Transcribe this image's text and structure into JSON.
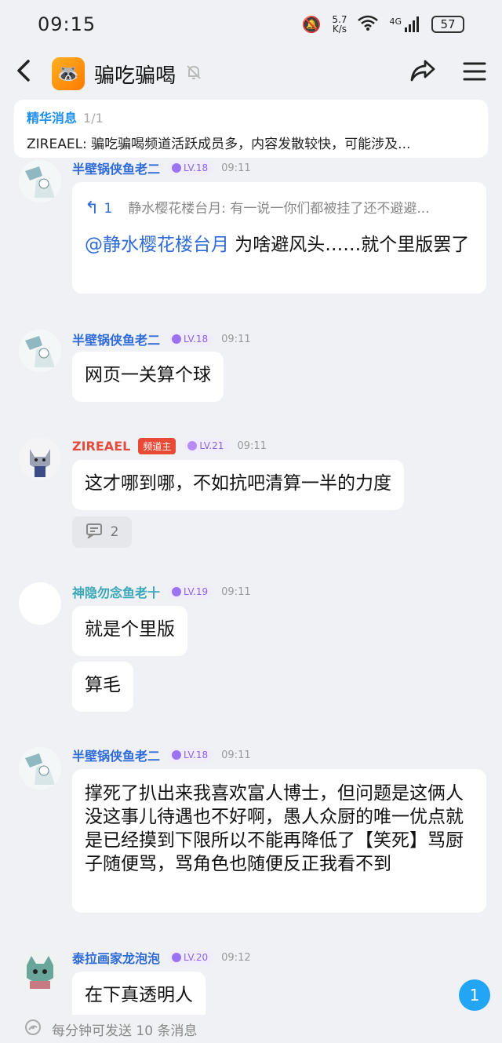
{
  "status": {
    "time": "09:15",
    "net_speed_value": "5.7",
    "net_speed_unit": "K/s",
    "signal": "4G",
    "battery": "57"
  },
  "header": {
    "title": "骗吃骗喝"
  },
  "pinned": {
    "title": "精华消息",
    "count": "1/1",
    "text": "ZIREAEL: 骗吃骗喝频道活跃成员多，内容发散较快，可能涉及..."
  },
  "messages": [
    {
      "name": "半壁锅侠鱼老二",
      "level": "LV.18",
      "time": "09:11",
      "quote_count": "1",
      "quote_text": "静水樱花楼台月: 有一说一你们都被挂了还不避避...",
      "mention": "@静水樱花楼台月",
      "text": " 为啥避风头……就个里版罢了"
    },
    {
      "name": "半壁锅侠鱼老二",
      "level": "LV.18",
      "time": "09:11",
      "text": "网页一关算个球"
    },
    {
      "name": "ZIREAEL",
      "role": "频道主",
      "level": "LV.21",
      "time": "09:11",
      "text": "这才哪到哪，不如抗吧清算一半的力度",
      "reply_count": "2"
    },
    {
      "name": "神隐勿念鱼老十",
      "level": "LV.19",
      "time": "09:11",
      "text": "就是个里版",
      "text2": "算毛"
    },
    {
      "name": "半壁锅侠鱼老二",
      "level": "LV.18",
      "time": "09:11",
      "text": "撑死了扒出来我喜欢富人博士，但问题是这俩人没这事儿待遇也不好啊，愚人众厨的唯一优点就是已经摸到下限所以不能再降低了【笑死】骂厨子随便骂，骂角色也随便反正我看不到"
    },
    {
      "name": "泰拉画家龙泡泡",
      "level": "LV.20",
      "time": "09:12",
      "text": "在下真透明人"
    }
  ],
  "unread_badge": "1",
  "footer": {
    "text": "每分钟可发送 10 条消息"
  },
  "icons": {
    "back": "back-arrow-icon",
    "mute": "bell-muted-icon",
    "share": "share-icon",
    "menu": "menu-icon",
    "reply": "comment-icon"
  }
}
